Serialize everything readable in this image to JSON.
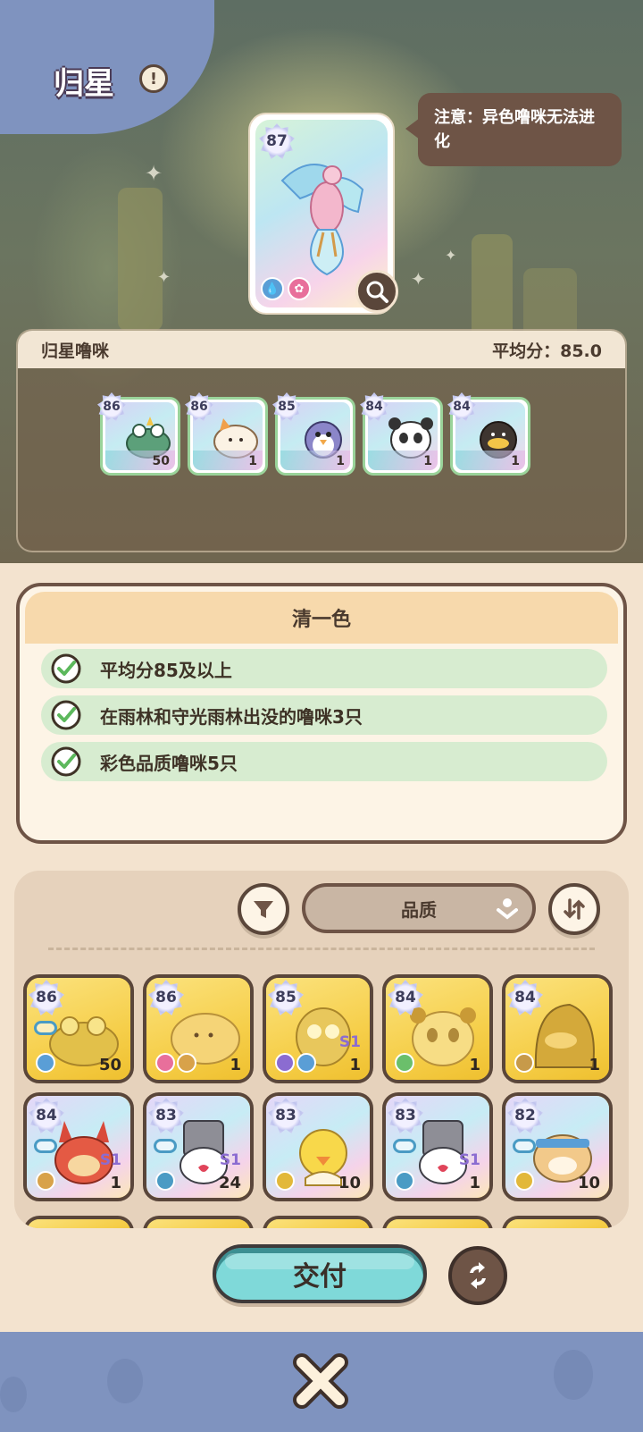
{
  "header": {
    "title": "归星"
  },
  "tooltip": {
    "text": "注意：异色噜咪无法进化"
  },
  "featured": {
    "level": "87",
    "element_icons": [
      "water-drop-icon",
      "flower-icon"
    ],
    "colors": {
      "water": "#5a9ed6",
      "flower": "#e86f9b"
    }
  },
  "selected": {
    "label": "归星噜咪",
    "average": "平均分：85.0",
    "items": [
      {
        "level": "86",
        "count": "50",
        "creature": "frog"
      },
      {
        "level": "86",
        "count": "1",
        "creature": "cat"
      },
      {
        "level": "85",
        "count": "1",
        "creature": "penguin"
      },
      {
        "level": "84",
        "count": "1",
        "creature": "panda"
      },
      {
        "level": "84",
        "count": "1",
        "creature": "platypus"
      }
    ]
  },
  "task": {
    "title": "清一色",
    "requirements": [
      "平均分85及以上",
      "在雨林和守光雨林出没的噜咪3只",
      "彩色品质噜咪5只"
    ]
  },
  "inventory": {
    "sort_label": "品质",
    "row1": [
      {
        "level": "86",
        "count": "50",
        "s1": "",
        "style": "gold",
        "creature": "frog"
      },
      {
        "level": "86",
        "count": "1",
        "s1": "",
        "style": "gold",
        "creature": "cat"
      },
      {
        "level": "85",
        "count": "1",
        "s1": "S1",
        "style": "gold",
        "creature": "penguin"
      },
      {
        "level": "84",
        "count": "1",
        "s1": "",
        "style": "gold",
        "creature": "panda"
      },
      {
        "level": "84",
        "count": "1",
        "s1": "",
        "style": "gold",
        "creature": "platypus"
      }
    ],
    "row2": [
      {
        "level": "84",
        "count": "1",
        "s1": "S1",
        "style": "holo",
        "creature": "rabbit"
      },
      {
        "level": "83",
        "count": "24",
        "s1": "S1",
        "style": "holo",
        "creature": "knight"
      },
      {
        "level": "83",
        "count": "10",
        "s1": "",
        "style": "holo",
        "creature": "chick"
      },
      {
        "level": "83",
        "count": "1",
        "s1": "S1",
        "style": "holo",
        "creature": "knight"
      },
      {
        "level": "82",
        "count": "10",
        "s1": "",
        "style": "holo",
        "creature": "hamster"
      }
    ]
  },
  "actions": {
    "deliver": "交付"
  }
}
